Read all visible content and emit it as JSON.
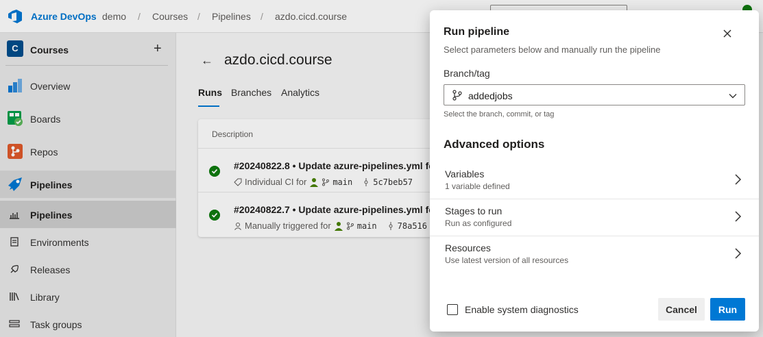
{
  "topbar": {
    "brand": "Azure DevOps",
    "breadcrumbs": [
      "demo",
      "Courses",
      "Pipelines",
      "azdo.cicd.course"
    ],
    "separator": "/"
  },
  "sidebar": {
    "project_badge": "C",
    "project_name": "Courses",
    "add_label": "+",
    "items": [
      {
        "label": "Overview",
        "icon": "overview-icon"
      },
      {
        "label": "Boards",
        "icon": "boards-icon"
      },
      {
        "label": "Repos",
        "icon": "repos-icon"
      },
      {
        "label": "Pipelines",
        "icon": "pipelines-icon"
      },
      {
        "label": "Pipelines",
        "icon": "pipelines-sub-icon"
      },
      {
        "label": "Environments",
        "icon": "environments-icon"
      },
      {
        "label": "Releases",
        "icon": "releases-icon"
      },
      {
        "label": "Library",
        "icon": "library-icon"
      },
      {
        "label": "Task groups",
        "icon": "task-groups-icon"
      }
    ]
  },
  "main": {
    "back_icon": "←",
    "title": "azdo.cicd.course",
    "tabs": [
      {
        "label": "Runs",
        "active": true
      },
      {
        "label": "Branches",
        "active": false
      },
      {
        "label": "Analytics",
        "active": false
      }
    ],
    "runs_header": "Description",
    "runs": [
      {
        "title": "#20240822.8 • Update azure-pipelines.yml fo",
        "trigger": "Individual CI for",
        "branch": "main",
        "commit": "5c7beb57",
        "status": "succeeded"
      },
      {
        "title": "#20240822.7 • Update azure-pipelines.yml fo",
        "trigger": "Manually triggered for",
        "branch": "main",
        "commit": "78a516",
        "status": "succeeded"
      }
    ]
  },
  "dialog": {
    "title": "Run pipeline",
    "subtitle": "Select parameters below and manually run the pipeline",
    "branch_label": "Branch/tag",
    "branch_value": "addedjobs",
    "branch_help": "Select the branch, commit, or tag",
    "advanced_title": "Advanced options",
    "options": [
      {
        "name": "Variables",
        "desc": "1 variable defined"
      },
      {
        "name": "Stages to run",
        "desc": "Run as configured"
      },
      {
        "name": "Resources",
        "desc": "Use latest version of all resources"
      }
    ],
    "diagnostics_label": "Enable system diagnostics",
    "diagnostics_checked": false,
    "cancel_label": "Cancel",
    "run_label": "Run"
  },
  "colors": {
    "accent": "#0078d4",
    "success": "#107c10"
  }
}
